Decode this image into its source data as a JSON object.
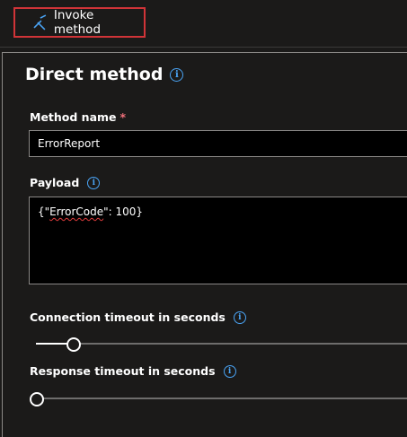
{
  "toolbar": {
    "invoke_label": "Invoke method",
    "invoke_icon": "invoke-method-icon"
  },
  "panel": {
    "title": "Direct method",
    "title_info": "i"
  },
  "method_name": {
    "label": "Method name",
    "required_mark": "*",
    "value": "ErrorReport"
  },
  "payload": {
    "label": "Payload",
    "info": "i",
    "value_prefix": "{\"",
    "value_misspelled": "ErrorCode",
    "value_suffix": "\": 100}"
  },
  "connection_timeout": {
    "label": "Connection timeout in seconds",
    "info": "i",
    "level_fraction": 0.1
  },
  "response_timeout": {
    "label": "Response timeout in seconds",
    "info": "i",
    "level_fraction": 0.0
  },
  "colors": {
    "accent_blue": "#4aa4f5",
    "highlight_red": "#d13438",
    "required_red": "#f1707b"
  }
}
